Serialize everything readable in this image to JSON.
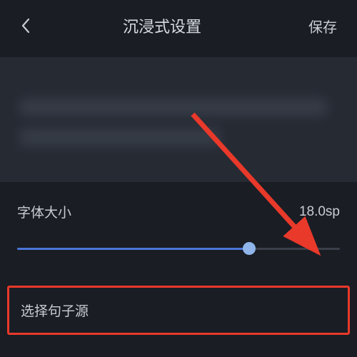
{
  "header": {
    "title": "沉浸式设置",
    "save_label": "保存"
  },
  "font": {
    "label": "字体大小",
    "value": "18.0sp",
    "slider_percent": 72
  },
  "sentence_source": {
    "label": "选择句子源"
  },
  "colors": {
    "highlight_border": "#e8392a",
    "slider_fill": "#4a76d8",
    "slider_thumb": "#8fb5ea"
  },
  "icons": {
    "back": "chevron-left-icon"
  }
}
